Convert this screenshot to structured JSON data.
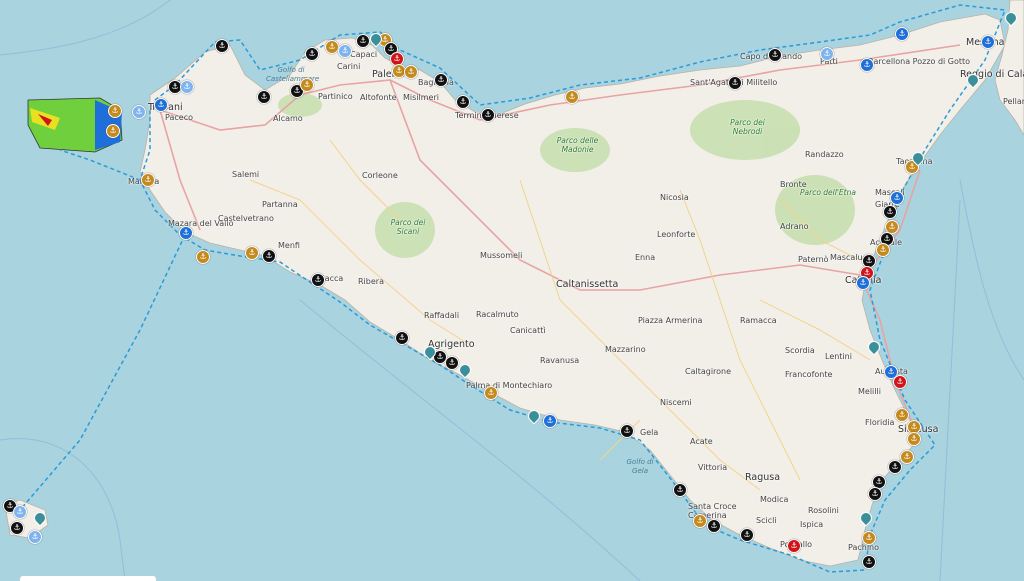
{
  "colors": {
    "sea": "#a9d3df",
    "land": "#f2efe9",
    "park": "#c8dfb0",
    "road_major": "#e8a3a3",
    "road_minor": "#f3d38a",
    "route": "#2a9bd8",
    "marker_black": "#111111",
    "marker_gold": "#c48a1e",
    "marker_blue": "#1e6fd9",
    "marker_red": "#d0141a",
    "marker_lightblue": "#7db4ef",
    "pin": "#3a8f9a"
  },
  "places": [
    {
      "name": "Trapani",
      "cls": "big"
    },
    {
      "name": "Paceco",
      "cls": ""
    },
    {
      "name": "Alcamo",
      "cls": ""
    },
    {
      "name": "Partinico",
      "cls": ""
    },
    {
      "name": "Carini",
      "cls": ""
    },
    {
      "name": "Capaci",
      "cls": ""
    },
    {
      "name": "Palermo",
      "cls": "big"
    },
    {
      "name": "Bagheria",
      "cls": ""
    },
    {
      "name": "Altofonte",
      "cls": ""
    },
    {
      "name": "Misilmeri",
      "cls": ""
    },
    {
      "name": "Termini Imerese",
      "cls": ""
    },
    {
      "name": "Capo d'Orlando",
      "cls": ""
    },
    {
      "name": "Patti",
      "cls": ""
    },
    {
      "name": "Barcellona Pozzo di Gotto",
      "cls": ""
    },
    {
      "name": "Messina",
      "cls": "big"
    },
    {
      "name": "Reggio di Calabria",
      "cls": "big"
    },
    {
      "name": "Sant'Agata di Militello",
      "cls": ""
    },
    {
      "name": "Randazzo",
      "cls": ""
    },
    {
      "name": "Bronte",
      "cls": ""
    },
    {
      "name": "Adrano",
      "cls": ""
    },
    {
      "name": "Paternò",
      "cls": ""
    },
    {
      "name": "Mascalucia",
      "cls": ""
    },
    {
      "name": "Catania",
      "cls": "big"
    },
    {
      "name": "Mascali",
      "cls": ""
    },
    {
      "name": "Giarre",
      "cls": ""
    },
    {
      "name": "Acireale",
      "cls": ""
    },
    {
      "name": "Taormina",
      "cls": ""
    },
    {
      "name": "Salemi",
      "cls": ""
    },
    {
      "name": "Marsala",
      "cls": ""
    },
    {
      "name": "Mazara del Vallo",
      "cls": ""
    },
    {
      "name": "Castelvetrano",
      "cls": ""
    },
    {
      "name": "Partanna",
      "cls": ""
    },
    {
      "name": "Menfi",
      "cls": ""
    },
    {
      "name": "Sciacca",
      "cls": ""
    },
    {
      "name": "Ribera",
      "cls": ""
    },
    {
      "name": "Corleone",
      "cls": ""
    },
    {
      "name": "Mussomeli",
      "cls": ""
    },
    {
      "name": "Nicosia",
      "cls": ""
    },
    {
      "name": "Leonforte",
      "cls": ""
    },
    {
      "name": "Enna",
      "cls": ""
    },
    {
      "name": "Caltanissetta",
      "cls": "big"
    },
    {
      "name": "Raffadali",
      "cls": ""
    },
    {
      "name": "Racalmuto",
      "cls": ""
    },
    {
      "name": "Canicattì",
      "cls": ""
    },
    {
      "name": "Agrigento",
      "cls": "big"
    },
    {
      "name": "Palma di Montechiaro",
      "cls": ""
    },
    {
      "name": "Ravanusa",
      "cls": ""
    },
    {
      "name": "Piazza Armerina",
      "cls": ""
    },
    {
      "name": "Mazzarino",
      "cls": ""
    },
    {
      "name": "Ramacca",
      "cls": ""
    },
    {
      "name": "Caltagirone",
      "cls": ""
    },
    {
      "name": "Niscemi",
      "cls": ""
    },
    {
      "name": "Scordia",
      "cls": ""
    },
    {
      "name": "Lentini",
      "cls": ""
    },
    {
      "name": "Francofonte",
      "cls": ""
    },
    {
      "name": "Augusta",
      "cls": ""
    },
    {
      "name": "Melilli",
      "cls": ""
    },
    {
      "name": "Floridia",
      "cls": ""
    },
    {
      "name": "Siracusa",
      "cls": "big"
    },
    {
      "name": "Gela",
      "cls": ""
    },
    {
      "name": "Acate",
      "cls": ""
    },
    {
      "name": "Vittoria",
      "cls": ""
    },
    {
      "name": "Ragusa",
      "cls": "big"
    },
    {
      "name": "Modica",
      "cls": ""
    },
    {
      "name": "Santa Croce Camerina",
      "cls": ""
    },
    {
      "name": "Scicli",
      "cls": ""
    },
    {
      "name": "Ispica",
      "cls": ""
    },
    {
      "name": "Rosolini",
      "cls": ""
    },
    {
      "name": "Pozzallo",
      "cls": ""
    },
    {
      "name": "Pachino",
      "cls": ""
    },
    {
      "name": "Pellaro",
      "cls": ""
    }
  ],
  "parks": [
    "Parco dei Nebrodi",
    "Parco delle Madonie",
    "Parco dell'Etna",
    "Parco dei Sicani"
  ],
  "seas": [
    "Golfo di Castellammare",
    "Golfo di Gela"
  ]
}
